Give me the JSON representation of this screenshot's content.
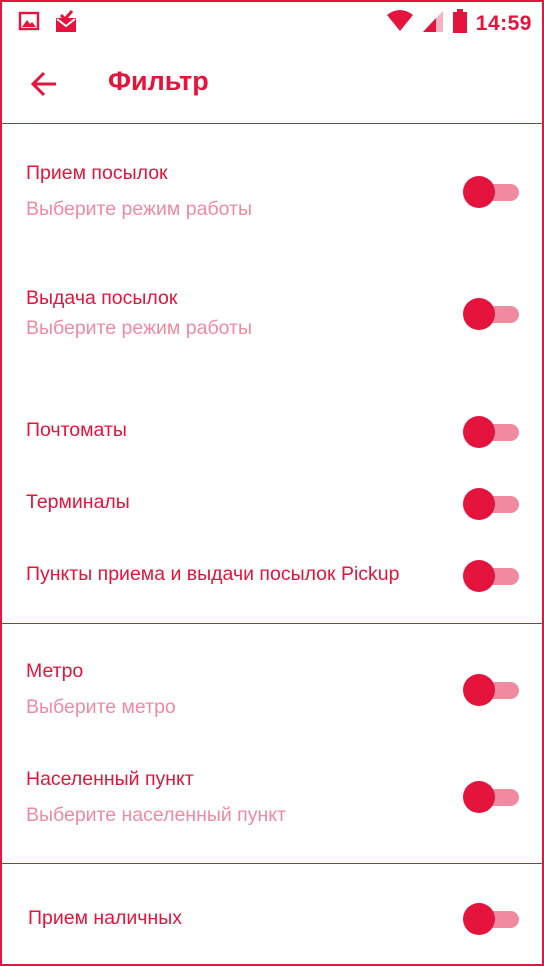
{
  "status_bar": {
    "time": "14:59",
    "icons": [
      "image-notification-icon",
      "mail-check-notification-icon",
      "wifi-icon",
      "cell-signal-icon",
      "battery-icon"
    ]
  },
  "toolbar": {
    "back_icon": "arrow-left-icon",
    "title": "Фильтр"
  },
  "colors": {
    "accent": "#e4143c",
    "subtext": "#ef8ba0",
    "track": "#f08aa0",
    "background": "#ffffff"
  },
  "filters": {
    "receive": {
      "label": "Прием посылок",
      "sub": "Выберите режим работы",
      "enabled": false
    },
    "issue": {
      "label": "Выдача посылок",
      "sub": "Выберите режим работы",
      "enabled": false
    },
    "parcel_lockers": {
      "label": "Почтоматы",
      "enabled": false
    },
    "terminals": {
      "label": "Терминалы",
      "enabled": false
    },
    "pickup": {
      "label": "Пункты приема и выдачи посылок Pickup",
      "enabled": false
    },
    "metro": {
      "label": "Метро",
      "sub": "Выберите метро",
      "enabled": false
    },
    "locality": {
      "label": "Населенный пункт",
      "sub": "Выберите населенный пункт",
      "enabled": false
    },
    "cash": {
      "label": "Прием наличных",
      "enabled": false
    }
  }
}
